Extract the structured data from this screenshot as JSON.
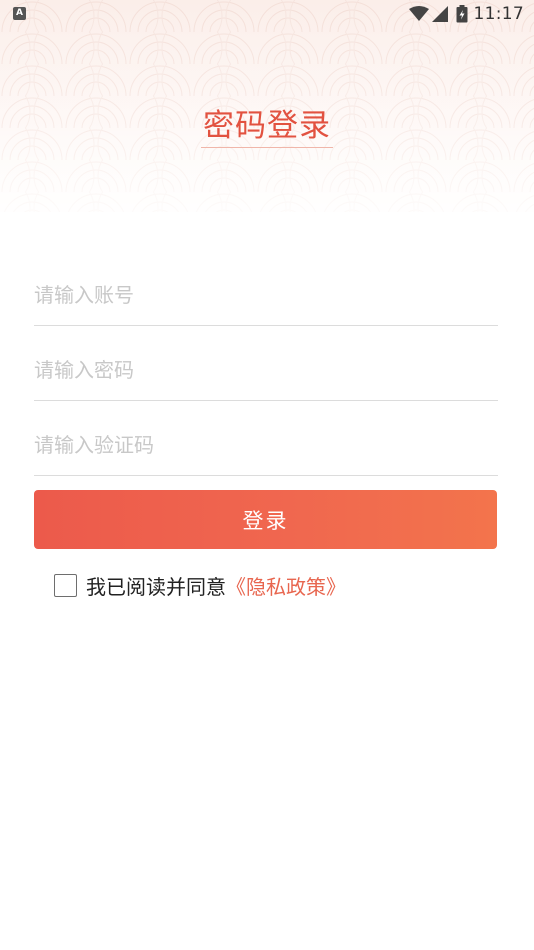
{
  "status_bar": {
    "left_icon": "A",
    "time": "11:17",
    "icons": [
      "wifi-icon",
      "cell-signal-icon",
      "battery-icon"
    ]
  },
  "title": "密码登录",
  "fields": {
    "account": {
      "value": "",
      "placeholder": "请输入账号"
    },
    "password": {
      "value": "",
      "placeholder": "请输入密码"
    },
    "captcha": {
      "value": "",
      "placeholder": "请输入验证码"
    }
  },
  "login_button": "登录",
  "agreement": {
    "checked": false,
    "text": "我已阅读并同意",
    "link": "《隐私政策》"
  },
  "colors": {
    "accent": "#e25240",
    "button_start": "#ec5a4b",
    "button_end": "#f3744c",
    "link": "#e8664f"
  }
}
